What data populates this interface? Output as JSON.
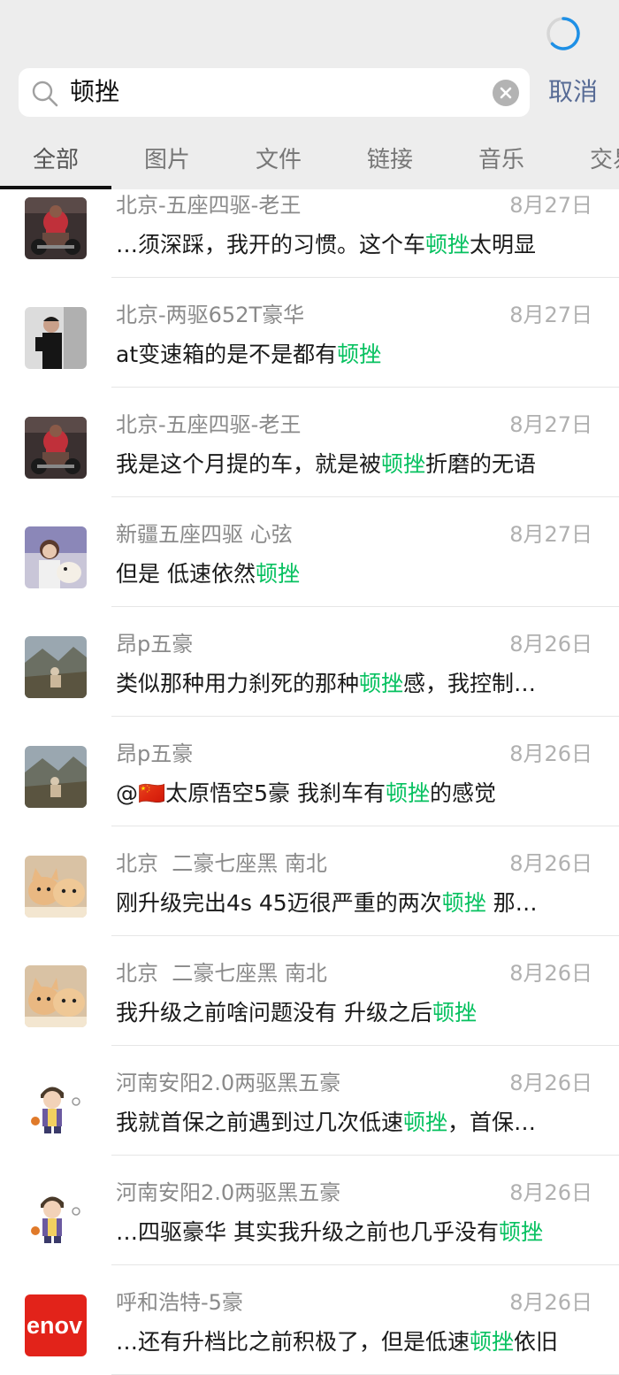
{
  "search": {
    "query": "顿挫"
  },
  "cancel_label": "取消",
  "tabs": [
    {
      "label": "全部"
    },
    {
      "label": "图片"
    },
    {
      "label": "文件"
    },
    {
      "label": "链接"
    },
    {
      "label": "音乐"
    },
    {
      "label": "交易"
    }
  ],
  "colors": {
    "highlight": "#07c160",
    "cancel": "#576b95"
  },
  "results": [
    {
      "name": "北京-五座四驱-老王",
      "date": "8月27日",
      "avatar": "gym-red",
      "msg": [
        {
          "text": "…须深踩，我开的习惯。这个车",
          "hl": false
        },
        {
          "text": "顿挫",
          "hl": true
        },
        {
          "text": "太明显",
          "hl": false
        }
      ]
    },
    {
      "name": "北京-两驱652T豪华",
      "date": "8月27日",
      "avatar": "man-dark",
      "msg": [
        {
          "text": "at变速箱的是不是都有",
          "hl": false
        },
        {
          "text": "顿挫",
          "hl": true
        }
      ]
    },
    {
      "name": "北京-五座四驱-老王",
      "date": "8月27日",
      "avatar": "gym-red",
      "msg": [
        {
          "text": "我是这个月提的车，就是被",
          "hl": false
        },
        {
          "text": "顿挫",
          "hl": true
        },
        {
          "text": "折磨的无语",
          "hl": false
        }
      ]
    },
    {
      "name": "新疆五座四驱 心弦",
      "date": "8月27日",
      "avatar": "girl-dog",
      "msg": [
        {
          "text": "但是 低速依然",
          "hl": false
        },
        {
          "text": "顿挫",
          "hl": true
        }
      ]
    },
    {
      "name": "昂p五豪",
      "date": "8月26日",
      "avatar": "mountain",
      "msg": [
        {
          "text": "类似那种用力刹死的那种",
          "hl": false
        },
        {
          "text": "顿挫",
          "hl": true
        },
        {
          "text": "感，我控制…",
          "hl": false
        }
      ]
    },
    {
      "name": "昂p五豪",
      "date": "8月26日",
      "avatar": "mountain",
      "msg": [
        {
          "text": "@🇨🇳太原悟空5豪 我刹车有",
          "hl": false
        },
        {
          "text": "顿挫",
          "hl": true
        },
        {
          "text": "的感觉",
          "hl": false
        }
      ]
    },
    {
      "name": "北京  二豪七座黑 南北",
      "date": "8月26日",
      "avatar": "cats",
      "msg": [
        {
          "text": "刚升级完出4s 45迈很严重的两次",
          "hl": false
        },
        {
          "text": "顿挫",
          "hl": true
        },
        {
          "text": " 那…",
          "hl": false
        }
      ]
    },
    {
      "name": "北京  二豪七座黑 南北",
      "date": "8月26日",
      "avatar": "cats",
      "msg": [
        {
          "text": "我升级之前啥问题没有 升级之后",
          "hl": false
        },
        {
          "text": "顿挫",
          "hl": true
        }
      ]
    },
    {
      "name": "河南安阳2.0两驱黑五豪",
      "date": "8月26日",
      "avatar": "cartoon-boy",
      "msg": [
        {
          "text": "我就首保之前遇到过几次低速",
          "hl": false
        },
        {
          "text": "顿挫",
          "hl": true
        },
        {
          "text": "，首保…",
          "hl": false
        }
      ]
    },
    {
      "name": "河南安阳2.0两驱黑五豪",
      "date": "8月26日",
      "avatar": "cartoon-boy",
      "msg": [
        {
          "text": "…四驱豪华 其实我升级之前也几乎没有",
          "hl": false
        },
        {
          "text": "顿挫",
          "hl": true
        }
      ]
    },
    {
      "name": "呼和浩特-5豪",
      "date": "8月26日",
      "avatar": "lenovo",
      "avatar_text": "enov",
      "msg": [
        {
          "text": "…还有升档比之前积极了，但是低速",
          "hl": false
        },
        {
          "text": "顿挫",
          "hl": true
        },
        {
          "text": "依旧",
          "hl": false
        }
      ]
    }
  ]
}
